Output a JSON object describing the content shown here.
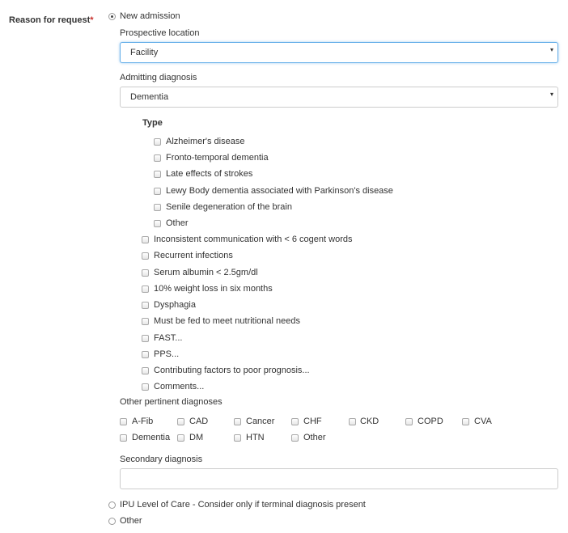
{
  "form": {
    "reason_label": "Reason for request",
    "required_marker": "*"
  },
  "reason_options": {
    "new_admission": "New admission",
    "ipu": "IPU Level of Care - Consider only if terminal diagnosis present",
    "other": "Other"
  },
  "prospective_location": {
    "label": "Prospective location",
    "value": "Facility"
  },
  "admitting_diagnosis": {
    "label": "Admitting diagnosis",
    "value": "Dementia"
  },
  "type_section": {
    "heading": "Type",
    "items": [
      "Alzheimer's disease",
      "Fronto-temporal dementia",
      "Late effects of strokes",
      "Lewy Body dementia associated with Parkinson's disease",
      "Senile degeneration of the brain",
      "Other"
    ]
  },
  "criteria": [
    "Inconsistent communication with < 6 cogent words",
    "Recurrent infections",
    "Serum albumin < 2.5gm/dl",
    "10% weight loss in six months",
    "Dysphagia",
    "Must be fed to meet nutritional needs",
    "FAST...",
    "PPS...",
    "Contributing factors to poor prognosis...",
    "Comments..."
  ],
  "other_pertinent": {
    "label": "Other pertinent diagnoses",
    "row1": [
      "A-Fib",
      "CAD",
      "Cancer",
      "CHF",
      "CKD",
      "COPD",
      "CVA"
    ],
    "row2": [
      "Dementia",
      "DM",
      "HTN",
      "Other"
    ]
  },
  "secondary_diagnosis": {
    "label": "Secondary diagnosis",
    "value": ""
  },
  "icons": {
    "caret": "▾"
  }
}
